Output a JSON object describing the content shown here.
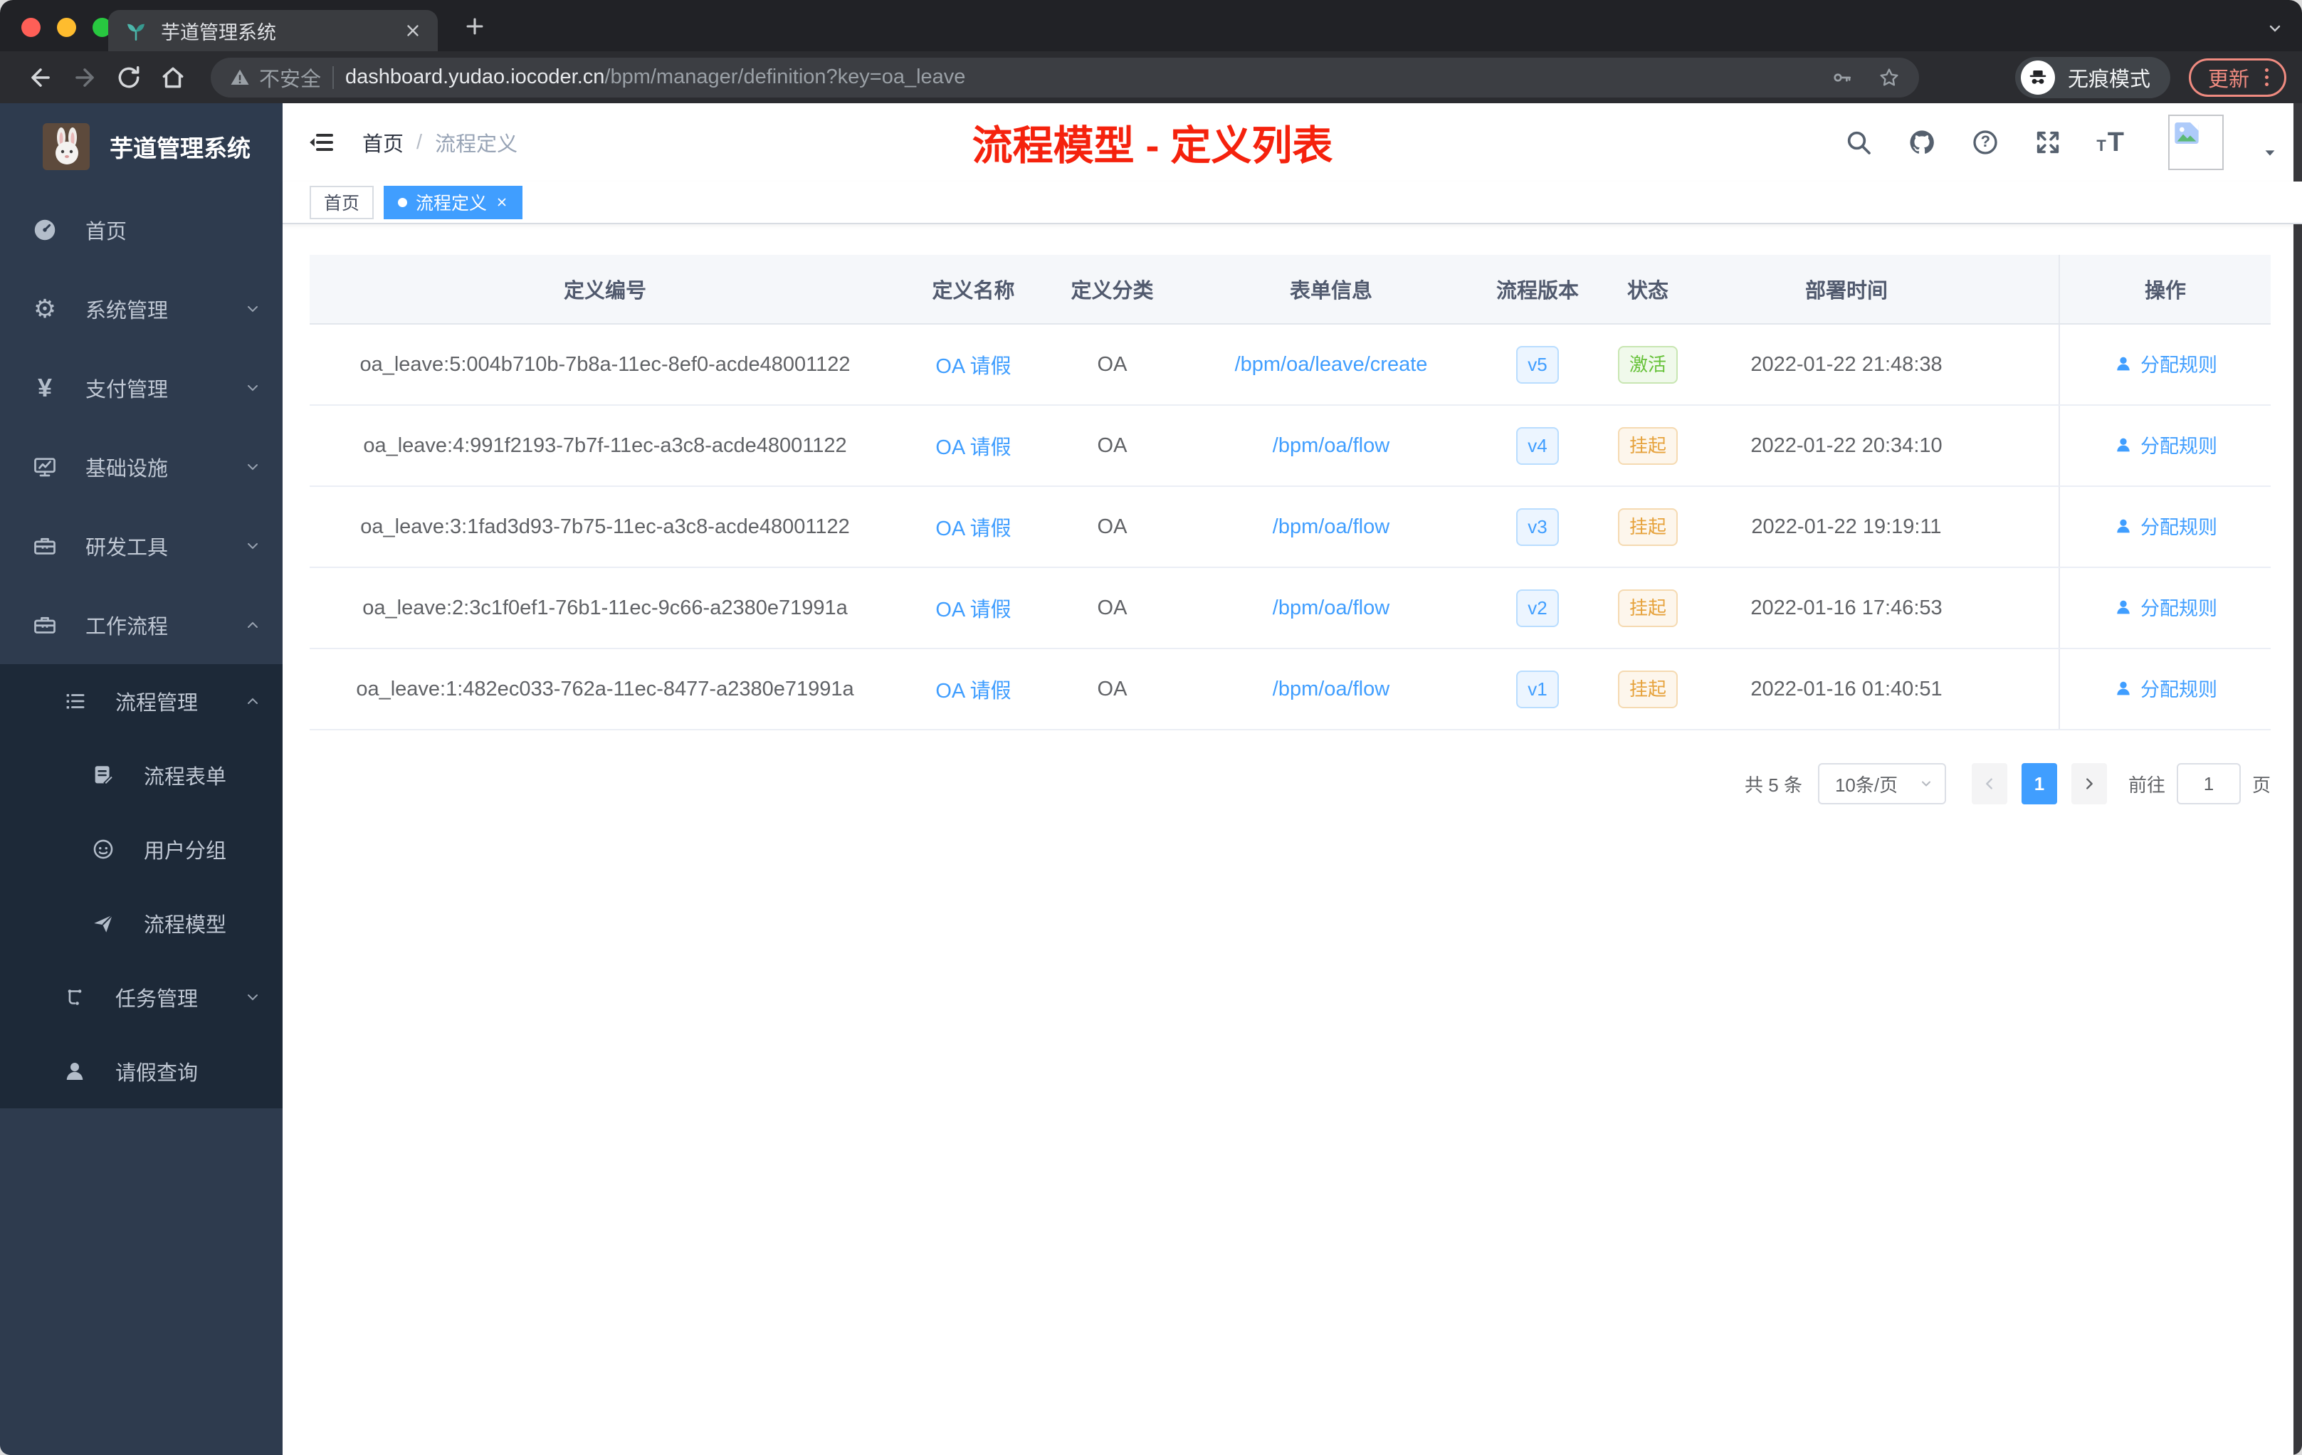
{
  "browser": {
    "tab_title": "芋道管理系统",
    "not_secure_label": "不安全",
    "url_host": "dashboard.yudao.iocoder.cn",
    "url_path": "/bpm/manager/definition?key=oa_leave",
    "incognito_label": "无痕模式",
    "update_label": "更新"
  },
  "icons": {
    "gear": "⚙",
    "yen": "¥",
    "question": "?",
    "font_large": "T",
    "font_small": "T",
    "slash": "/"
  },
  "sidebar": {
    "logo_title": "芋道管理系统",
    "items": [
      {
        "label": "首页",
        "icon": "dashboard-icon"
      },
      {
        "label": "系统管理",
        "icon": "gear-icon"
      },
      {
        "label": "支付管理",
        "icon": "yen-icon"
      },
      {
        "label": "基础设施",
        "icon": "monitor-icon"
      },
      {
        "label": "研发工具",
        "icon": "toolbox-icon"
      },
      {
        "label": "工作流程",
        "icon": "briefcase-icon"
      }
    ],
    "submenu": [
      {
        "label": "流程管理",
        "icon": "list-icon"
      },
      {
        "label": "流程表单",
        "icon": "form-icon"
      },
      {
        "label": "用户分组",
        "icon": "user-group-icon"
      },
      {
        "label": "流程模型",
        "icon": "paper-plane-icon"
      },
      {
        "label": "任务管理",
        "icon": "tree-icon"
      },
      {
        "label": "请假查询",
        "icon": "person-icon"
      }
    ]
  },
  "navbar": {
    "breadcrumb": [
      "首页",
      "流程定义"
    ],
    "annotation_title": "流程模型 - 定义列表"
  },
  "tags": [
    {
      "label": "首页"
    },
    {
      "label": "流程定义"
    }
  ],
  "table": {
    "columns": [
      "定义编号",
      "定义名称",
      "定义分类",
      "表单信息",
      "流程版本",
      "状态",
      "部署时间",
      "操作"
    ],
    "rows": [
      {
        "id": "oa_leave:5:004b710b-7b8a-11ec-8ef0-acde48001122",
        "name": "OA 请假",
        "category": "OA",
        "form": "/bpm/oa/leave/create",
        "version": "v5",
        "status": "激活",
        "time": "2022-01-22 21:48:38",
        "action": "分配规则"
      },
      {
        "id": "oa_leave:4:991f2193-7b7f-11ec-a3c8-acde48001122",
        "name": "OA 请假",
        "category": "OA",
        "form": "/bpm/oa/flow",
        "version": "v4",
        "status": "挂起",
        "time": "2022-01-22 20:34:10",
        "action": "分配规则"
      },
      {
        "id": "oa_leave:3:1fad3d93-7b75-11ec-a3c8-acde48001122",
        "name": "OA 请假",
        "category": "OA",
        "form": "/bpm/oa/flow",
        "version": "v3",
        "status": "挂起",
        "time": "2022-01-22 19:19:11",
        "action": "分配规则"
      },
      {
        "id": "oa_leave:2:3c1f0ef1-76b1-11ec-9c66-a2380e71991a",
        "name": "OA 请假",
        "category": "OA",
        "form": "/bpm/oa/flow",
        "version": "v2",
        "status": "挂起",
        "time": "2022-01-16 17:46:53",
        "action": "分配规则"
      },
      {
        "id": "oa_leave:1:482ec033-762a-11ec-8477-a2380e71991a",
        "name": "OA 请假",
        "category": "OA",
        "form": "/bpm/oa/flow",
        "version": "v1",
        "status": "挂起",
        "time": "2022-01-16 01:40:51",
        "action": "分配规则"
      }
    ]
  },
  "pagination": {
    "total": "共 5 条",
    "page_size": "10条/页",
    "current_page": "1",
    "goto_label": "前往",
    "goto_value": "1",
    "page_unit": "页"
  },
  "colors": {
    "accent": "#409eff",
    "success": "#67c23a",
    "warning": "#e6a23c",
    "annotation_red": "#f5220d",
    "sidebar_bg": "#2e3b4e",
    "submenu_bg": "#1d2938"
  }
}
